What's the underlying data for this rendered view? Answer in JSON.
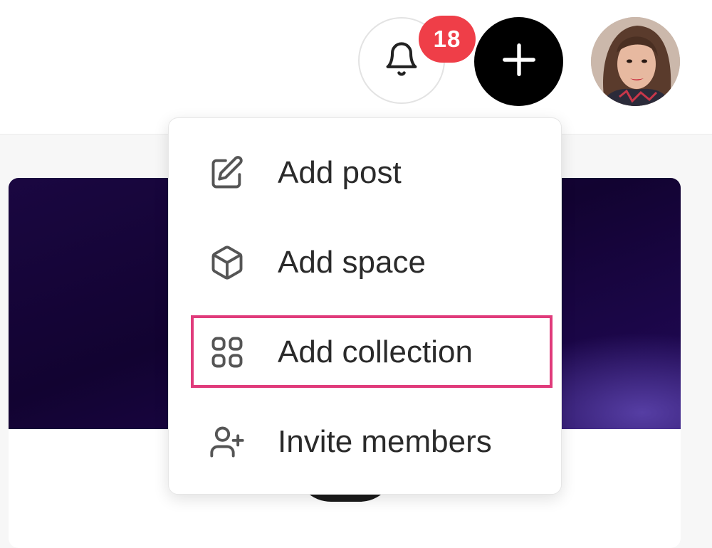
{
  "header": {
    "notification_count": "18",
    "colors": {
      "badge": "#ef3e48",
      "create_button": "#000000"
    }
  },
  "menu": {
    "items": [
      {
        "label": "Add post",
        "icon": "edit-icon"
      },
      {
        "label": "Add space",
        "icon": "cube-icon"
      },
      {
        "label": "Add collection",
        "icon": "grid-icon",
        "highlighted": true
      },
      {
        "label": "Invite members",
        "icon": "user-plus-icon"
      }
    ],
    "highlight_color": "#e03b7b"
  }
}
